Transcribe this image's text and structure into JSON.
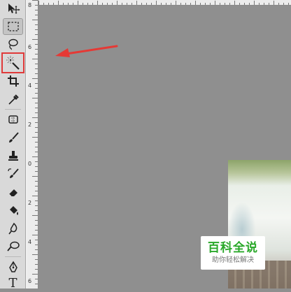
{
  "tools": [
    {
      "id": "move",
      "name": "move-tool-icon"
    },
    {
      "id": "marquee",
      "name": "rectangular-marquee-tool-icon"
    },
    {
      "id": "lasso",
      "name": "lasso-tool-icon"
    },
    {
      "id": "magic_wand",
      "name": "magic-wand-tool-icon",
      "highlighted": true
    },
    {
      "id": "crop",
      "name": "crop-tool-icon"
    },
    {
      "id": "eyedropper",
      "name": "eyedropper-tool-icon"
    },
    {
      "id": "healing",
      "name": "spot-healing-brush-tool-icon"
    },
    {
      "id": "brush",
      "name": "brush-tool-icon"
    },
    {
      "id": "stamp",
      "name": "clone-stamp-tool-icon"
    },
    {
      "id": "history_brush",
      "name": "history-brush-tool-icon"
    },
    {
      "id": "eraser",
      "name": "eraser-tool-icon"
    },
    {
      "id": "bucket",
      "name": "paint-bucket-tool-icon"
    },
    {
      "id": "blur",
      "name": "blur-tool-icon"
    },
    {
      "id": "dodge",
      "name": "dodge-tool-icon"
    },
    {
      "id": "pen",
      "name": "pen-tool-icon"
    },
    {
      "id": "type",
      "name": "type-tool-icon",
      "label": "T"
    }
  ],
  "vertical_ruler": {
    "labels": [
      "8",
      "6",
      "4",
      "2",
      "0",
      "2",
      "4",
      "6"
    ]
  },
  "watermark": {
    "title": "百科全说",
    "subtitle": "助你轻松解决"
  },
  "colors": {
    "highlight": "#e03a3a",
    "arrow": "#e53935",
    "watermark_green": "#2aa82a"
  }
}
